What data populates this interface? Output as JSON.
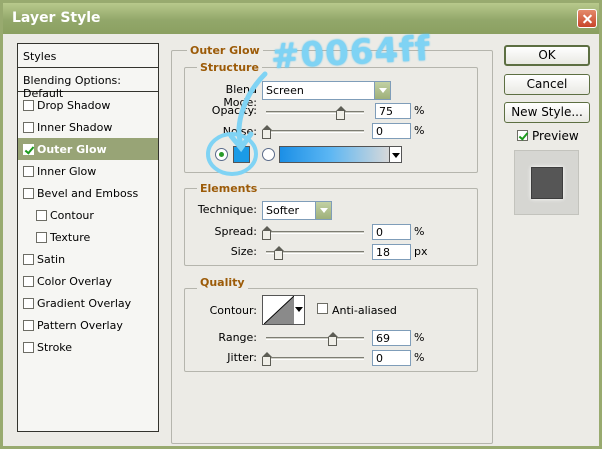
{
  "window": {
    "title": "Layer Style"
  },
  "styles_panel": {
    "header": "Styles",
    "blending_options": "Blending Options: Default",
    "items": [
      {
        "label": "Drop Shadow",
        "checked": false,
        "selected": false,
        "indent": false
      },
      {
        "label": "Inner Shadow",
        "checked": false,
        "selected": false,
        "indent": false
      },
      {
        "label": "Outer Glow",
        "checked": true,
        "selected": true,
        "indent": false
      },
      {
        "label": "Inner Glow",
        "checked": false,
        "selected": false,
        "indent": false
      },
      {
        "label": "Bevel and Emboss",
        "checked": false,
        "selected": false,
        "indent": false
      },
      {
        "label": "Contour",
        "checked": false,
        "selected": false,
        "indent": true
      },
      {
        "label": "Texture",
        "checked": false,
        "selected": false,
        "indent": true
      },
      {
        "label": "Satin",
        "checked": false,
        "selected": false,
        "indent": false
      },
      {
        "label": "Color Overlay",
        "checked": false,
        "selected": false,
        "indent": false
      },
      {
        "label": "Gradient Overlay",
        "checked": false,
        "selected": false,
        "indent": false
      },
      {
        "label": "Pattern Overlay",
        "checked": false,
        "selected": false,
        "indent": false
      },
      {
        "label": "Stroke",
        "checked": false,
        "selected": false,
        "indent": false
      }
    ]
  },
  "outer_glow": {
    "section_title": "Outer Glow",
    "structure": {
      "title": "Structure",
      "blend_mode_label": "Blend Mode:",
      "blend_mode_value": "Screen",
      "opacity_label": "Opacity:",
      "opacity_value": "75",
      "opacity_unit": "%",
      "noise_label": "Noise:",
      "noise_value": "0",
      "noise_unit": "%",
      "glow_color": "#0064ff",
      "solid_color_selected": true
    },
    "elements": {
      "title": "Elements",
      "technique_label": "Technique:",
      "technique_value": "Softer",
      "spread_label": "Spread:",
      "spread_value": "0",
      "spread_unit": "%",
      "size_label": "Size:",
      "size_value": "18",
      "size_unit": "px"
    },
    "quality": {
      "title": "Quality",
      "contour_label": "Contour:",
      "anti_aliased_label": "Anti-aliased",
      "anti_aliased": false,
      "range_label": "Range:",
      "range_value": "69",
      "range_unit": "%",
      "jitter_label": "Jitter:",
      "jitter_value": "0",
      "jitter_unit": "%"
    }
  },
  "buttons": {
    "ok": "OK",
    "cancel": "Cancel",
    "new_style": "New Style...",
    "preview_label": "Preview",
    "preview_checked": true
  },
  "annotation": {
    "text": "#0064ff",
    "color": "#7fd3f4"
  }
}
